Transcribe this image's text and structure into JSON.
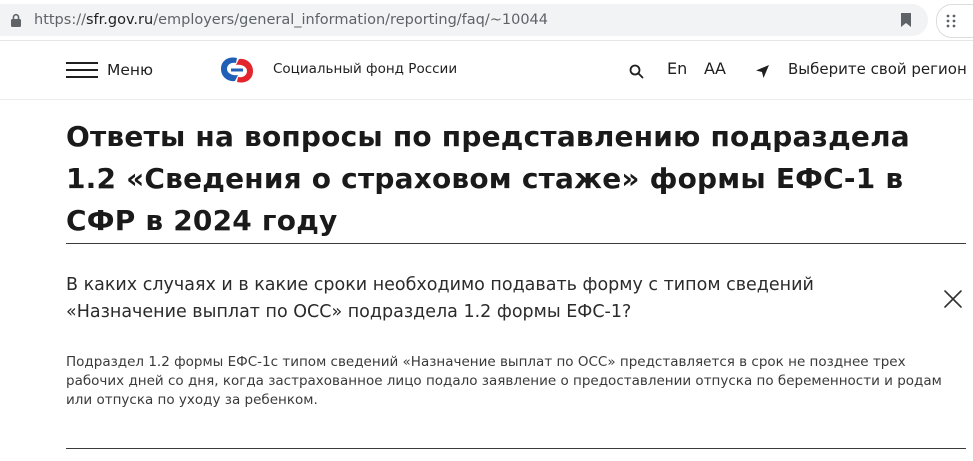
{
  "browser": {
    "url_scheme": "https://",
    "url_host": "sfr.gov.ru",
    "url_path": "/employers/general_information/reporting/faq/~10044"
  },
  "header": {
    "menu_label": "Меню",
    "org_name": "Социальный фонд России",
    "lang_label": "En",
    "accessibility_label": "АА",
    "region_label": "Выберите свой регион",
    "icons": [
      "search-icon",
      "location-arrow-icon",
      "logo-icon"
    ]
  },
  "main": {
    "title": "Ответы на вопросы по представлению подраздела 1.2 «Сведения о страховом стаже» формы ЕФС-1 в СФР в 2024 году",
    "faq": {
      "question": "В каких случаях и в какие сроки необходимо подавать форму с типом сведений «Назначение выплат по ОСС» подраздела 1.2 формы ЕФС-1?",
      "answer": "Подраздел 1.2 формы ЕФС-1с типом сведений «Назначение выплат по ОСС» представляется в срок не позднее трех рабочих дней со дня, когда застрахованное лицо подало заявление о предоставлении отпуска по беременности и родам или отпуска по уходу за ребенком."
    }
  },
  "colors": {
    "logo_blue": "#1f5fb5",
    "logo_red": "#e3262b",
    "text": "#1f1f1f",
    "address_bar": "#f1f3f4"
  }
}
